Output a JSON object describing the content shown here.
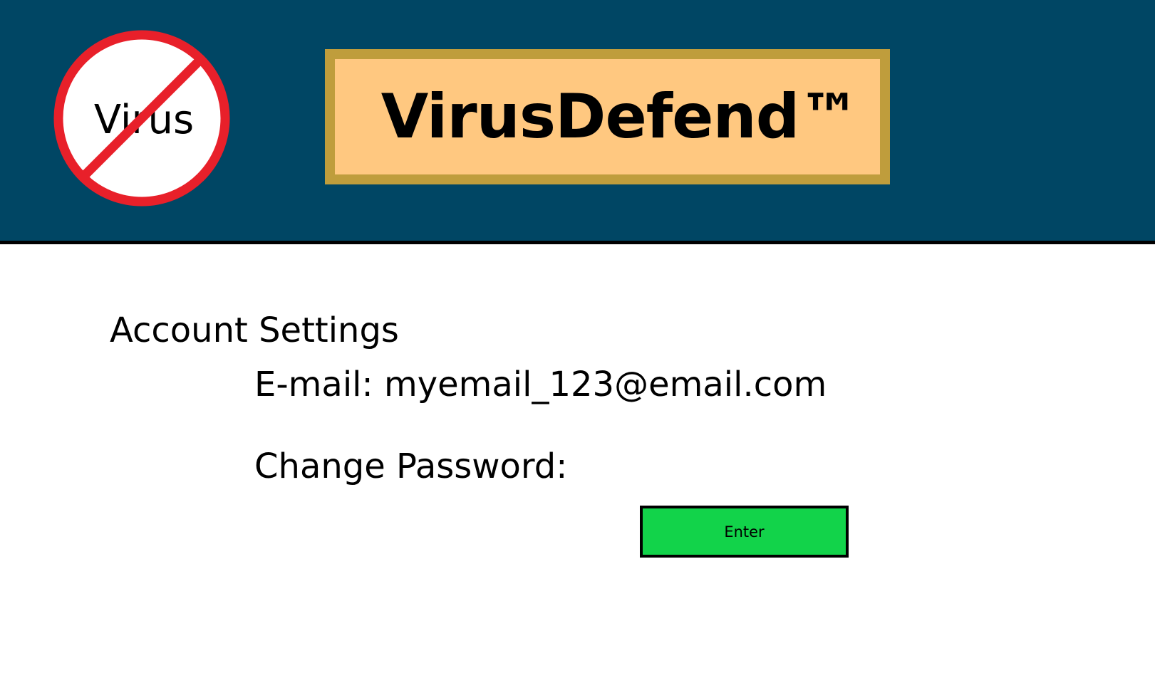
{
  "header": {
    "logo_text": "Virus",
    "logo_icon": "no-virus-prohibition-icon",
    "app_title": "VirusDefend™"
  },
  "main": {
    "heading": "Account Settings",
    "email_label": "E-mail:",
    "email_value": "myemail_123@email.com",
    "change_password_label": "Change Password:",
    "enter_button_label": "Enter"
  },
  "colors": {
    "header_bg": "#004664",
    "title_box_bg": "#ffc880",
    "title_box_border": "#bf9d3c",
    "prohibition_red": "#e8202a",
    "enter_button_bg": "#12d34a"
  }
}
